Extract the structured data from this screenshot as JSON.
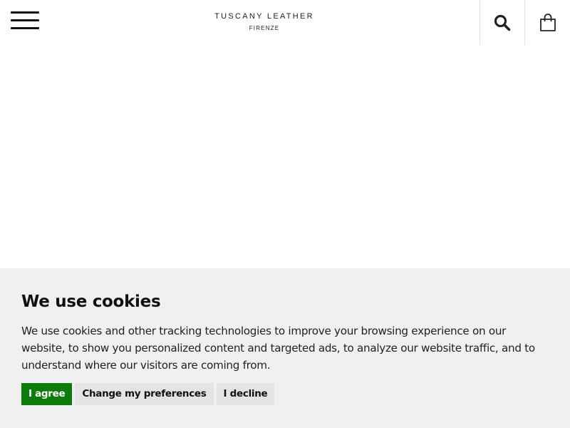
{
  "header": {
    "menu_icon": "hamburger-menu-icon",
    "logo_title": "TUSCANY LEATHER",
    "logo_subtitle": "FIRENZE",
    "search_icon": "search-icon",
    "cart_icon": "shopping-bag-icon"
  },
  "cookie": {
    "title": "We use cookies",
    "text": "We use cookies and other tracking technologies to improve your browsing experience on our website, to show you personalized content and targeted ads, to analyze our website traffic, and to understand where our visitors are coming from.",
    "agree_label": "I agree",
    "prefs_label": "Change my preferences",
    "decline_label": "I decline"
  },
  "colors": {
    "agree_bg": "#0c7a0c",
    "banner_bg": "#f0f0f0",
    "secondary_btn_bg": "#e4e4e4"
  }
}
